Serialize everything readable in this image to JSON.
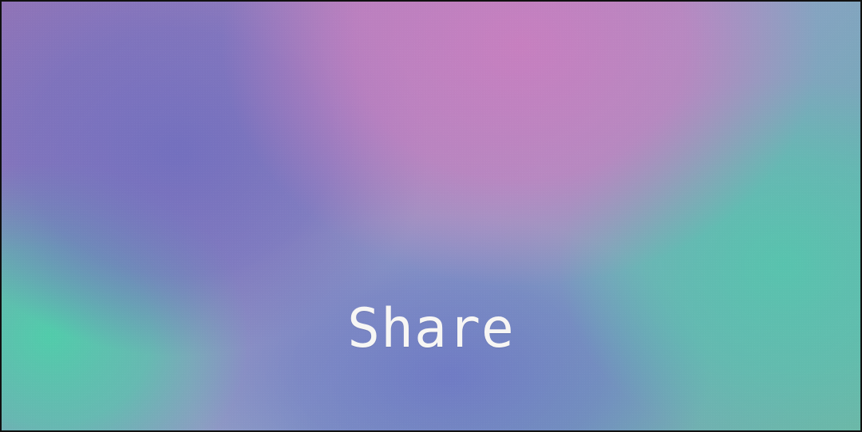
{
  "screen": {
    "label": "Share"
  }
}
